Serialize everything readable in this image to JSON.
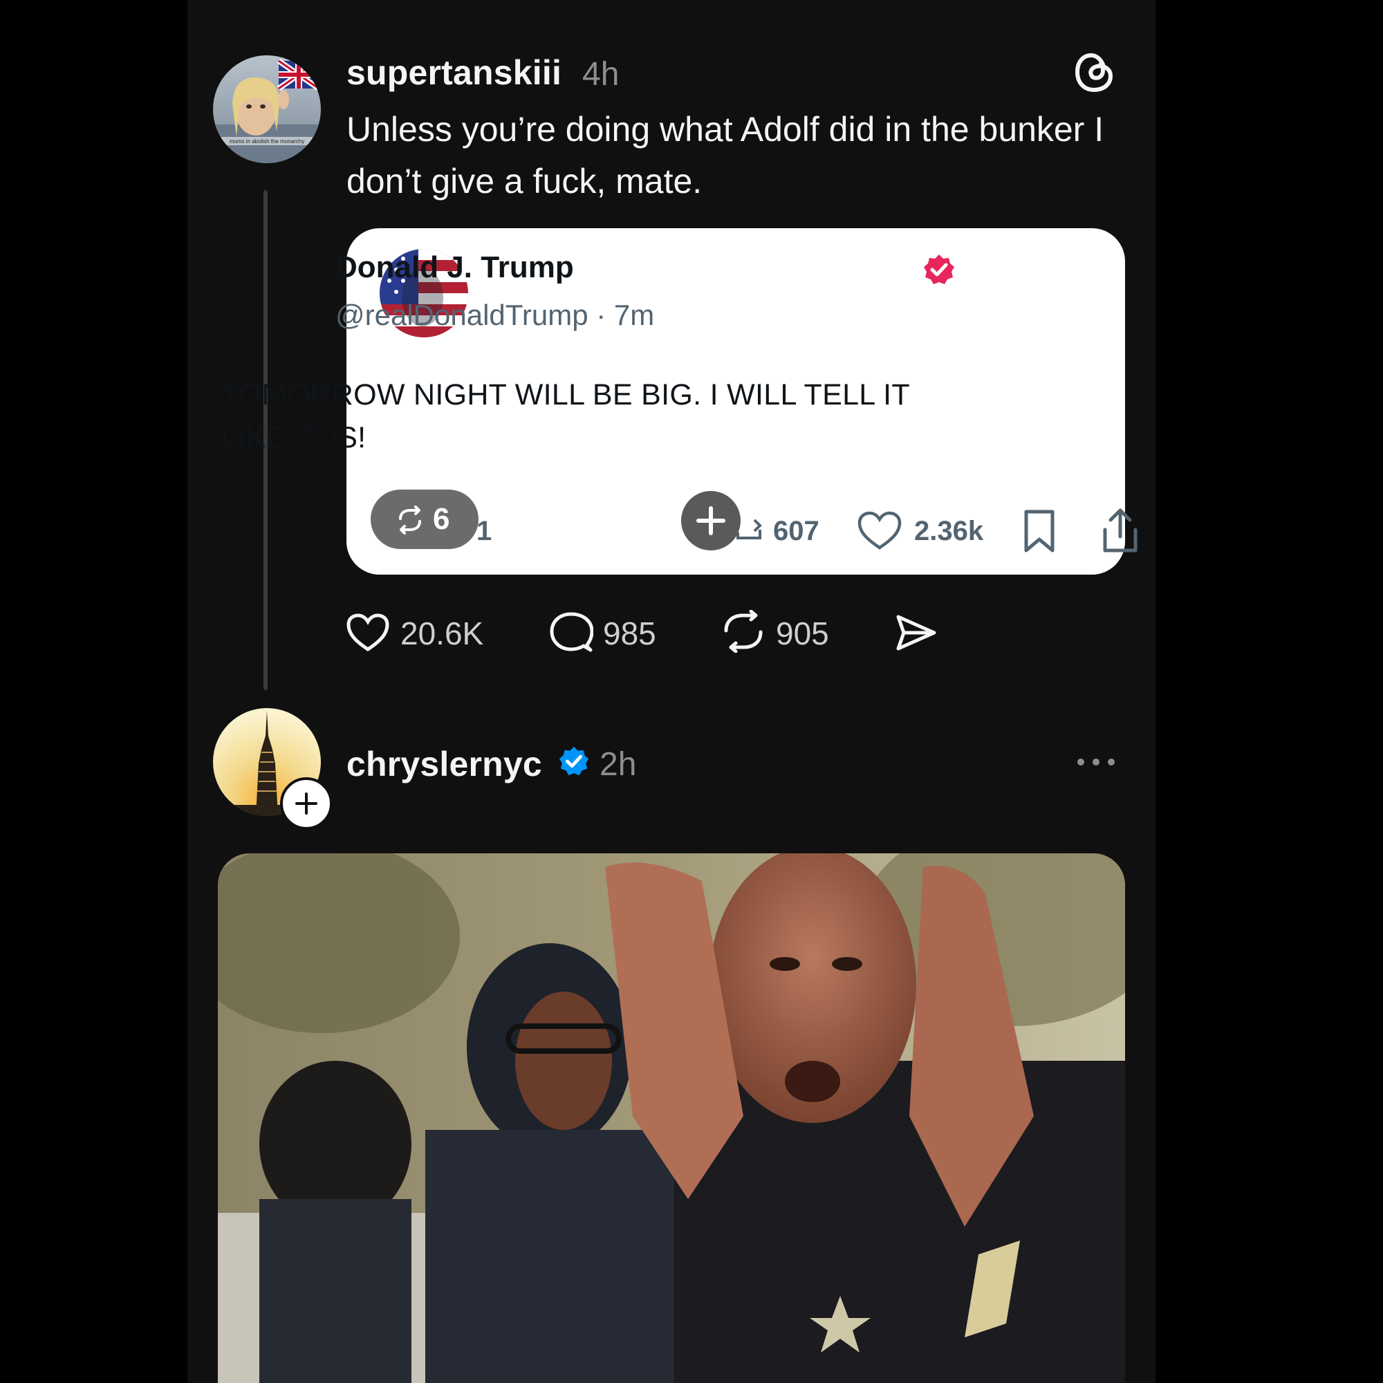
{
  "post1": {
    "username": "supertanskiii",
    "time": "4h",
    "avatar_caption": "mums in abolish the monarchy",
    "text": "Unless you’re doing what Adolf did in the bunker I don’t give a fuck, mate.",
    "quoted": {
      "name": "Donald J. Trump",
      "handle_time": "@realDonaldTrump · 7m",
      "text": "TOMORROW NIGHT WILL BE BIG. I WILL TELL IT LIKE IT IS!",
      "pill_count": "6",
      "reply_partial": "1",
      "retruths": "607",
      "likes": "2.36k"
    },
    "likes": "20.6K",
    "replies": "985",
    "reposts": "905"
  },
  "post2": {
    "username": "chryslernyc",
    "time": "2h"
  },
  "colors": {
    "background": "#101010",
    "text": "#f3f5f7",
    "muted": "#8e8e8e",
    "verified_blue": "#0095f6",
    "truth_verified": "#e8265e"
  }
}
